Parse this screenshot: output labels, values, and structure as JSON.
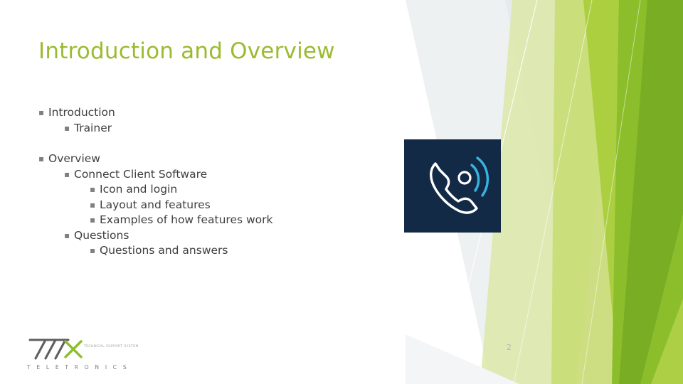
{
  "slide": {
    "title": "Introduction and Overview",
    "slide_number": "2",
    "colors": {
      "title": "#9bbb2f",
      "body_text": "#3f3f3f",
      "bullet_marker": "#808080",
      "accent_green_light": "#c3d84a",
      "accent_green_mid": "#9dc429",
      "accent_green_dark": "#7ba428",
      "accent_gray": "#e9ecee",
      "image_bg": "#132a47",
      "image_stroke": "#ffffff",
      "image_accent": "#35b4e0"
    },
    "bullets": [
      {
        "level": 1,
        "text": "Introduction",
        "marker": "▪"
      },
      {
        "level": 2,
        "text": "Trainer",
        "marker": "▪"
      },
      {
        "level": 1,
        "text": "Overview",
        "marker": "▪"
      },
      {
        "level": 2,
        "text": "Connect Client Software",
        "marker": "▪"
      },
      {
        "level": 3,
        "text": "Icon and login",
        "marker": "▪"
      },
      {
        "level": 3,
        "text": "Layout and features",
        "marker": "▪"
      },
      {
        "level": 3,
        "text": "Examples of how features work",
        "marker": "▪"
      },
      {
        "level": 2,
        "text": "Questions",
        "marker": "▪"
      },
      {
        "level": 3,
        "text": "Questions and answers",
        "marker": "▪"
      }
    ],
    "logo": {
      "brand": "TTX",
      "wordmark": "T E L E T R O N I C S",
      "tagline": "TECHNICAL SUPPORT SYSTEM"
    },
    "image": {
      "alt": "phone-with-signal-waves-icon"
    }
  }
}
